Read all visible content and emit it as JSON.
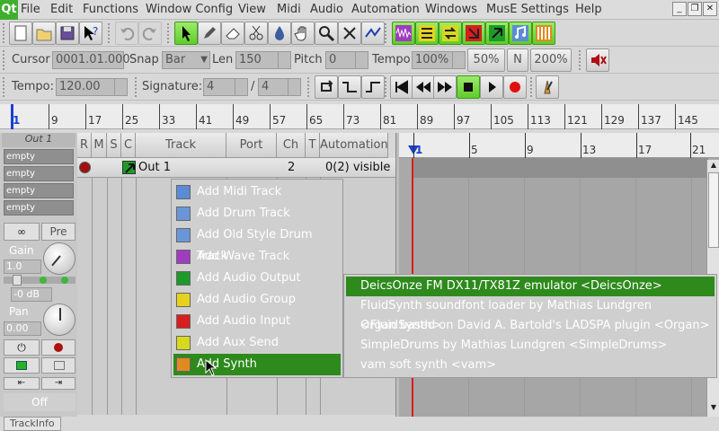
{
  "menubar": {
    "logo": "Qt",
    "items": [
      "File",
      "Edit",
      "Functions",
      "Window Config",
      "View",
      "Midi",
      "Audio",
      "Automation",
      "Windows",
      "MusE Settings",
      "Help"
    ]
  },
  "edit_toolbar": {
    "cursor_label": "Cursor",
    "cursor_value": "0001.01.000",
    "snap_label": "Snap",
    "snap_value": "Bar",
    "len_label": "Len",
    "len_value": "150",
    "pitch_label": "Pitch",
    "pitch_value": "0",
    "tempo_label": "Tempo",
    "tempo_value": "100%",
    "tempo_50": "50%",
    "tempo_n": "N",
    "tempo_200": "200%"
  },
  "transport": {
    "tempo_label": "Tempo:",
    "tempo_value": "120.00",
    "signature_label": "Signature:",
    "sig_num": "4",
    "sig_den": "4"
  },
  "ruler": {
    "marks": [
      "1",
      "9",
      "17",
      "25",
      "33",
      "41",
      "49",
      "57",
      "65",
      "73",
      "81",
      "89",
      "97",
      "105",
      "113",
      "121",
      "129",
      "137",
      "145"
    ]
  },
  "arranger_ruler": {
    "marks": [
      "1",
      "5",
      "9",
      "13",
      "17",
      "21"
    ]
  },
  "strip": {
    "title": "Out 1",
    "routes": [
      "empty",
      "empty",
      "empty",
      "empty"
    ],
    "pre": "Pre",
    "gain_label": "Gain",
    "gain_value": "1.0",
    "db_value": "-0 dB",
    "pan_label": "Pan",
    "pan_value": "0.00",
    "off_label": "Off",
    "trackinfo_tab": "TrackInfo"
  },
  "tracklist": {
    "headers": [
      "R",
      "M",
      "S",
      "C",
      "Track",
      "Port",
      "Ch",
      "T",
      "Automation"
    ],
    "track": {
      "name": "Out 1",
      "channel": "2",
      "automation": "0(2) visible"
    }
  },
  "context_menu": {
    "items": [
      {
        "label": "Add Midi Track",
        "icon": "midi-track-icon",
        "color": "#5a8cd6"
      },
      {
        "label": "Add Drum Track",
        "icon": "drum-track-icon",
        "color": "#6a96d8"
      },
      {
        "label": "Add Old Style Drum Track",
        "icon": "old-drum-track-icon",
        "color": "#6a96d8"
      },
      {
        "label": "Add Wave Track",
        "icon": "wave-track-icon",
        "color": "#a03cc0"
      },
      {
        "label": "Add Audio Output",
        "icon": "audio-output-icon",
        "color": "#1e9a2a"
      },
      {
        "label": "Add Audio Group",
        "icon": "audio-group-icon",
        "color": "#e6d21e"
      },
      {
        "label": "Add Audio Input",
        "icon": "audio-input-icon",
        "color": "#d81e1e"
      },
      {
        "label": "Add Aux Send",
        "icon": "aux-send-icon",
        "color": "#d8d81e"
      },
      {
        "label": "Add Synth",
        "icon": "synth-icon",
        "color": "#e08a20"
      }
    ]
  },
  "synth_submenu": {
    "items": [
      "DeicsOnze FM DX11/TX81Z emulator <DeicsOnze>",
      "FluidSynth soundfont loader by Mathias Lundgren <FluidSynth>",
      "Organ based on David A. Bartold's LADSPA plugin <Organ>",
      "SimpleDrums by Mathias Lundgren <SimpleDrums>",
      "vam soft synth <vam>"
    ]
  },
  "colors": {
    "highlight": "#2e8a1c",
    "menu_bg": "#cfcfcf",
    "toolbar_green": "#6ad03a",
    "record_red": "#e01010"
  }
}
